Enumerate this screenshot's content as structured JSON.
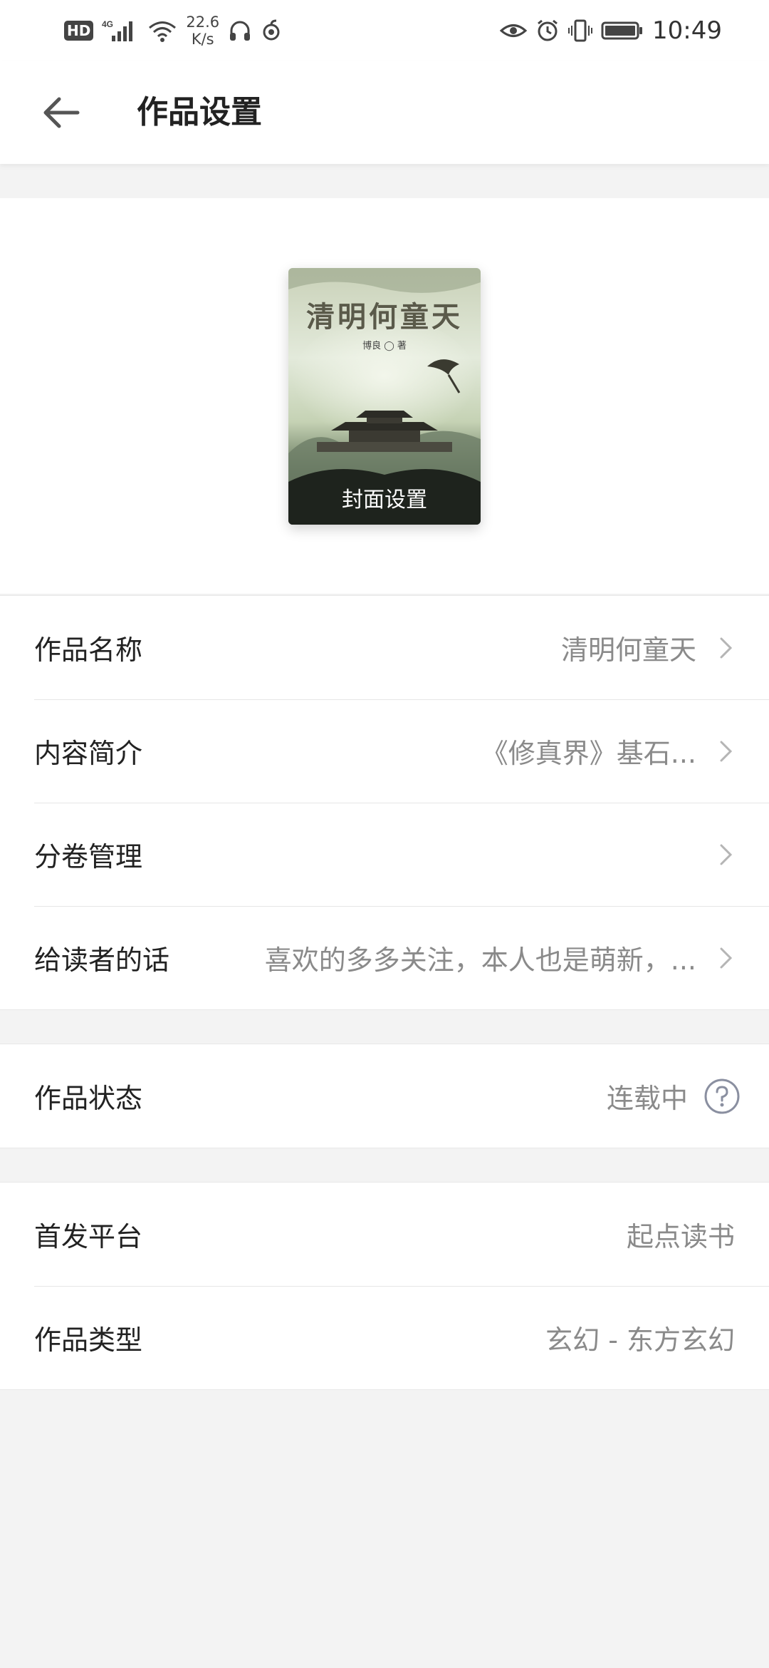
{
  "status_bar": {
    "hd": "HD",
    "network": "4G",
    "speed_value": "22.6",
    "speed_unit": "K/s",
    "time": "10:49"
  },
  "header": {
    "title": "作品设置"
  },
  "cover": {
    "art_title": "清明何童天",
    "art_author": "博良 ◯ 著",
    "label": "封面设置"
  },
  "details": [
    {
      "label": "作品名称",
      "value": "清明何童天"
    },
    {
      "label": "内容简介",
      "value": "《修真界》基石..."
    },
    {
      "label": "分卷管理",
      "value": ""
    },
    {
      "label": "给读者的话",
      "value": "喜欢的多多关注，本人也是萌新，..."
    }
  ],
  "status": {
    "label": "作品状态",
    "value": "连载中"
  },
  "meta": [
    {
      "label": "首发平台",
      "value": "起点读书"
    },
    {
      "label": "作品类型",
      "value": "玄幻 - 东方玄幻"
    }
  ],
  "colors": {
    "background": "#f3f3f3",
    "text_primary": "#222222",
    "text_secondary": "#8a8a8a"
  }
}
